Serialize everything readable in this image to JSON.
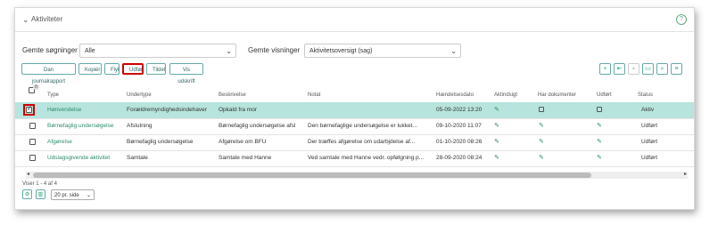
{
  "panel": {
    "title": "Aktiviteter",
    "help_icon": "?"
  },
  "filters": {
    "saved_searches_label": "Gemte søgninger",
    "saved_searches_value": "Alle",
    "saved_views_label": "Gemte visninger",
    "saved_views_value": "Aktivitetsoversigt (sag)"
  },
  "toolbar": {
    "buttons": [
      "Dan journalrapport",
      "Kopiér",
      "Flyt",
      "Udfør",
      "Tildel",
      "Vis udskrift"
    ],
    "icon_buttons": [
      "add-icon",
      "import-icon",
      "lock-icon",
      "document-icon",
      "search-icon",
      "columns-icon"
    ]
  },
  "table": {
    "headers": [
      "Type",
      "Undertype",
      "Beskrivelse",
      "Notat",
      "Hændelsesdato",
      "Aktindsigt",
      "Har dokumenter",
      "Udført",
      "Status"
    ],
    "header_badge": "0",
    "rows": [
      {
        "type": "Hønvendelse",
        "undertype": "Forældremyndighedsindehaver",
        "beskrivelse": "Opkald fra mor",
        "notat": "",
        "dato": "05-09-2022 13:20",
        "aktindsigt": true,
        "har_dokumenter": false,
        "udfort": false,
        "status": "Aktiv",
        "checked": true
      },
      {
        "type": "Børnefaglig undersøgelse",
        "undertype": "Afslutning",
        "beskrivelse": "Børnefaglig undersøgelse afsl",
        "notat": "Den børnefaglige undersøgelse er lukket...",
        "dato": "09-10-2020 11:07",
        "aktindsigt": true,
        "har_dokumenter": true,
        "udfort": true,
        "status": "Udført",
        "checked": false
      },
      {
        "type": "Afgørelse",
        "undertype": "Børnefaglig undersøgelse",
        "beskrivelse": "Afgørelse om BFU",
        "notat": "Der træffes afgørelse om udarbjdelse af...",
        "dato": "01-10-2020 08:26",
        "aktindsigt": true,
        "har_dokumenter": true,
        "udfort": true,
        "status": "Udført",
        "checked": false
      },
      {
        "type": "Udslagsgivende aktivitet",
        "undertype": "Samtale",
        "beskrivelse": "Samtale med Hanne",
        "notat": "Ved samtale med Hanne vedr. opfølgning p...",
        "dato": "28-09-2020 08:24",
        "aktindsigt": true,
        "har_dokumenter": true,
        "udfort": true,
        "status": "Udført",
        "checked": false
      }
    ]
  },
  "footer": {
    "count_text": "Viser 1 - 4 af 4",
    "page_size": "20 pr. side"
  },
  "colors": {
    "accent": "#2e8b6e",
    "selected_row": "#b7e4dc",
    "highlight": "#d00000"
  }
}
